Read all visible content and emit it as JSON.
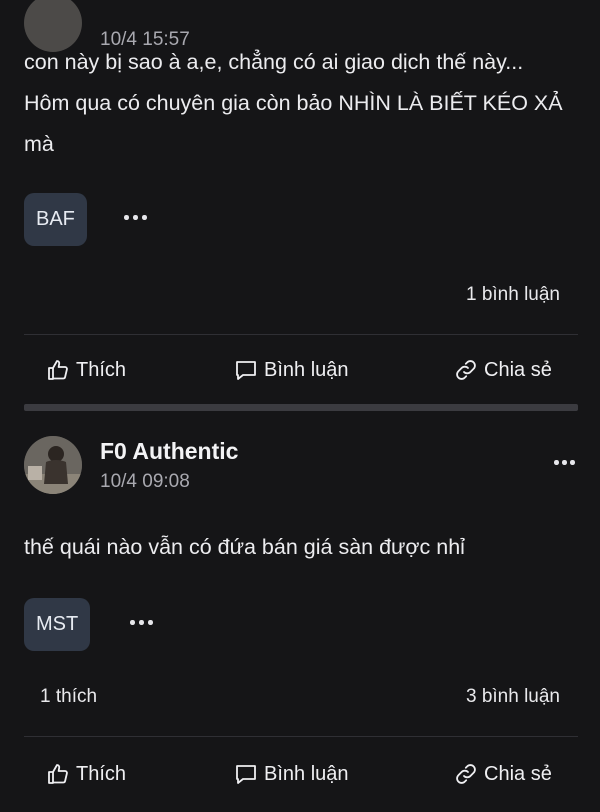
{
  "posts": [
    {
      "author": "",
      "time": "10/4 15:57",
      "content": "con này bị sao à a,e, chẳng có ai giao dịch thế này... Hôm qua có chuyên gia còn bảo NHÌN LÀ BIẾT KÉO XẢ mà",
      "tag": "BAF",
      "likes": "",
      "comments": "1 bình luận"
    },
    {
      "author": "F0 Authentic",
      "time": "10/4 09:08",
      "content": "thế quái nào vẫn có đứa bán giá sàn được nhỉ",
      "tag": "MST",
      "likes": "1 thích",
      "comments": "3 bình luận"
    }
  ],
  "actions": {
    "like": "Thích",
    "comment": "Bình luận",
    "share": "Chia sẻ"
  },
  "icons": [
    "thumbs-up-icon",
    "comment-icon",
    "link-icon",
    "more-icon"
  ],
  "colors": {
    "background": "#151517",
    "tag_bg": "#303846",
    "text": "#e9e9ec",
    "muted": "#a9a9b0"
  }
}
